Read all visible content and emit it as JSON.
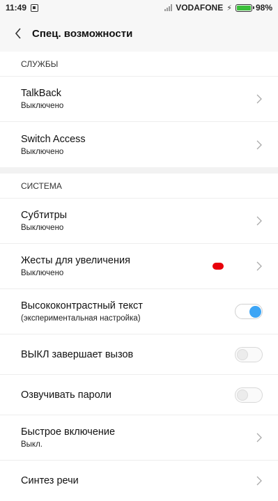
{
  "status_bar": {
    "time": "11:49",
    "carrier": "VODAFONE",
    "battery": "98%",
    "battery_level": 0.98
  },
  "header": {
    "title": "Спец. возможности"
  },
  "sections": {
    "services": {
      "title": "СЛУЖБЫ",
      "items": [
        {
          "title": "TalkBack",
          "subtitle": "Выключено"
        },
        {
          "title": "Switch Access",
          "subtitle": "Выключено"
        }
      ]
    },
    "system": {
      "title": "СИСТЕМА",
      "items": [
        {
          "title": "Субтитры",
          "subtitle": "Выключено"
        },
        {
          "title": "Жесты для увеличения",
          "subtitle": "Выключено"
        },
        {
          "title": "Высококонтрастный текст",
          "subtitle": "(экспериментальная настройка)",
          "toggle": true
        },
        {
          "title": "ВЫКЛ завершает вызов",
          "toggle": false
        },
        {
          "title": "Озвучивать пароли",
          "toggle": false
        },
        {
          "title": "Быстрое включение",
          "subtitle": "Выкл."
        },
        {
          "title": "Синтез речи"
        }
      ]
    }
  },
  "colors": {
    "accent": "#3da5f5",
    "battery": "#3bbf3b",
    "marker": "#e8000a"
  }
}
